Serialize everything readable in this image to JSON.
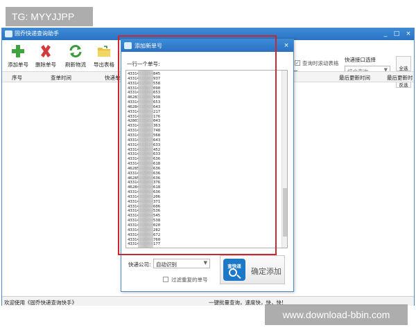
{
  "watermarks": {
    "top": "TG: MYYJJPP",
    "bottom": "www.download-bbin.com"
  },
  "window": {
    "title": "固乔快递查询助手",
    "controls": {
      "minimize": "_",
      "maximize": "□",
      "close": "×"
    }
  },
  "toolbar": {
    "add": "添加单号",
    "delete": "删除单号",
    "refresh": "刷新物流",
    "export": "导出表格"
  },
  "grid": {
    "columns": {
      "seq": "序号",
      "query_time": "查单时间",
      "courier": "快递单",
      "last_update_time": "最后更新时间",
      "last_update": "最后更新时"
    }
  },
  "right_panel": {
    "interface_label": "快递接口选择",
    "interface_value": "综合查询",
    "scroll_checkbox_label": "查询时滚动表格",
    "speed_label": "快",
    "select_all": "全选",
    "invert": "反选"
  },
  "statusbar": {
    "left": "欢迎使用《固乔快递查询快手》",
    "right": "一键批量查询，速度快，快，快!"
  },
  "dialog": {
    "title": "添加新单号",
    "close": "×",
    "hint": "一行一个单号:",
    "tracking_numbers": [
      "43314511254845",
      "43314515464937",
      "43314515497558",
      "43314519977090",
      "43314515491653",
      "46283115497938",
      "43314515497653",
      "46284115425643",
      "43314515434217",
      "43314515498176",
      "42803115432043",
      "43314515497363",
      "43314515497748",
      "43314515481568",
      "43314515415643",
      "43314511525633",
      "43314512532452",
      "43314515497633",
      "43314515497636",
      "43314515494618",
      "46285215494636",
      "43314415494636",
      "46285215494636",
      "43314415494376",
      "46284615494618",
      "43314415494636",
      "43314315494206",
      "43314415494371",
      "43314415494606",
      "43314315494536",
      "43314315494545",
      "43314315494538",
      "43314315494020",
      "43314315491282",
      "43314315491672",
      "43314315490760",
      "43314315498177"
    ],
    "company_label": "快递公司:",
    "company_value": "自动识别",
    "dedupe_label": "过滤重复的单号",
    "logo_text": "查快递",
    "confirm_add": "确定添加"
  }
}
